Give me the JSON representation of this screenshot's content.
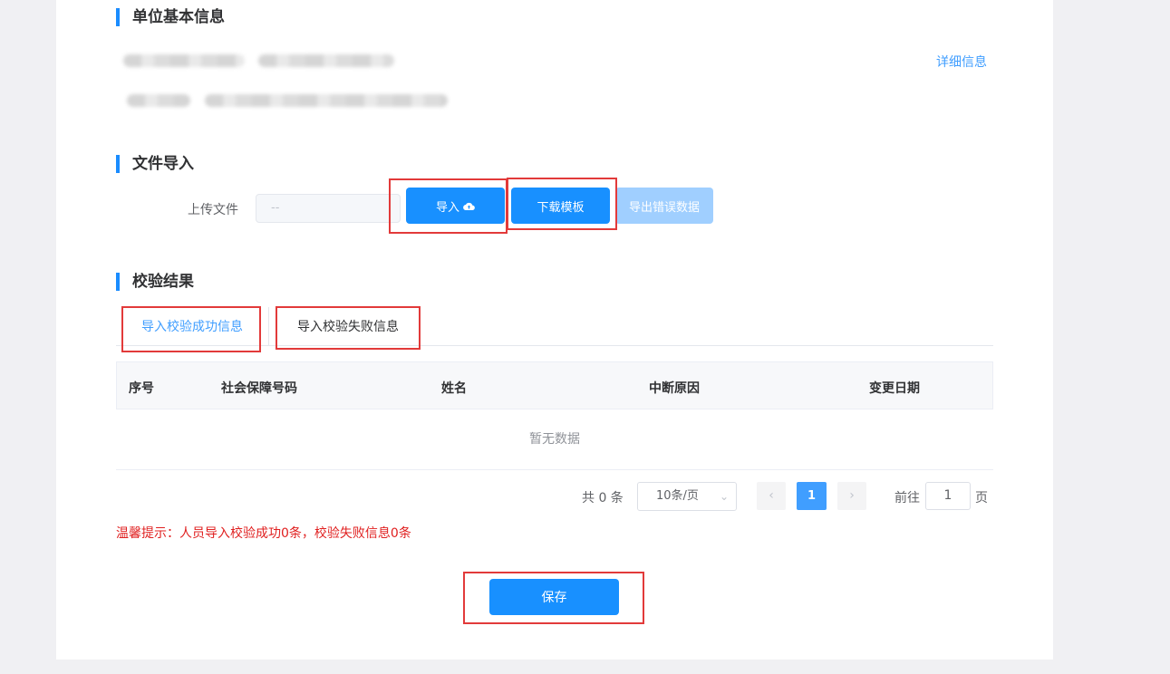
{
  "sections": {
    "basic_info": "单位基本信息",
    "file_import": "文件导入",
    "check_result": "校验结果"
  },
  "basic_info": {
    "detail_link": "详细信息"
  },
  "upload": {
    "label": "上传文件",
    "value": "--",
    "import_button": "导入",
    "download_template_button": "下载模板",
    "export_errors_button": "导出错误数据"
  },
  "tabs": [
    "导入校验成功信息",
    "导入校验失败信息"
  ],
  "table": {
    "columns": [
      "序号",
      "社会保障号码",
      "姓名",
      "中断原因",
      "变更日期"
    ],
    "empty_text": "暂无数据"
  },
  "pagination": {
    "total": "共 0 条",
    "page_size": "10条/页",
    "current_page": "1",
    "goto_label": "前往",
    "goto_value": "1",
    "goto_unit": "页"
  },
  "tip": "温馨提示：人员导入校验成功0条，校验失败信息0条",
  "save_button": "保存",
  "colors": {
    "primary": "#1890ff",
    "link": "#409eff",
    "warning": "#e02020",
    "highlight_box": "#e23a3a"
  }
}
